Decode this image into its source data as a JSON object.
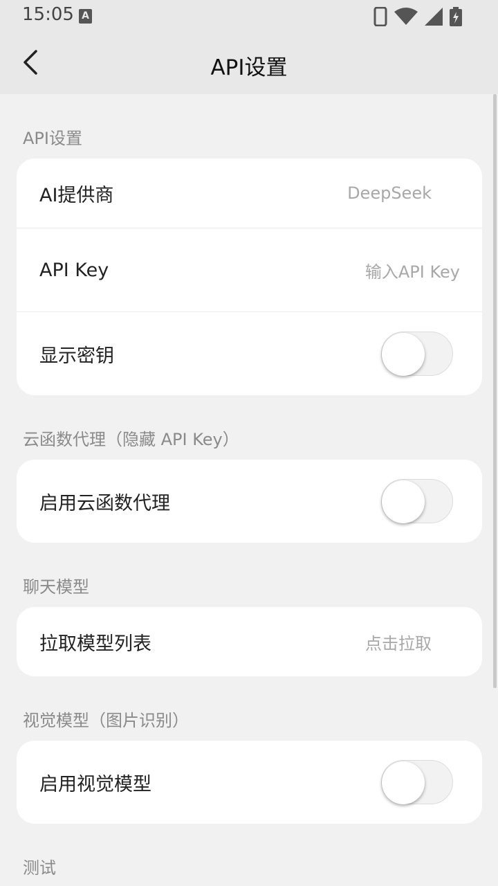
{
  "status_bar": {
    "time": "15:05",
    "app_icon_letter": "A",
    "icons": [
      "phone-icon",
      "wifi-icon",
      "signal-icon",
      "battery-charging-icon"
    ]
  },
  "header": {
    "title": "API设置",
    "back_icon": "chevron-left-icon"
  },
  "sections": {
    "api": {
      "title": "API设置",
      "provider_label": "AI提供商",
      "provider_value": "DeepSeek",
      "api_key_label": "API Key",
      "api_key_placeholder": "输入API Key",
      "show_key_label": "显示密钥",
      "show_key_enabled": false
    },
    "proxy": {
      "title": "云函数代理（隐藏 API Key）",
      "enable_label": "启用云函数代理",
      "enabled": false
    },
    "chat_model": {
      "title": "聊天模型",
      "fetch_label": "拉取模型列表",
      "fetch_action": "点击拉取"
    },
    "vision_model": {
      "title": "视觉模型（图片识别）",
      "enable_label": "启用视觉模型",
      "enabled": false
    },
    "test": {
      "title": "测试"
    }
  },
  "colors": {
    "background": "#f1f1f1",
    "bar": "#e8e8e8",
    "card": "#ffffff",
    "section_label": "#8a8a8a",
    "value_text": "#a8a8a8"
  }
}
